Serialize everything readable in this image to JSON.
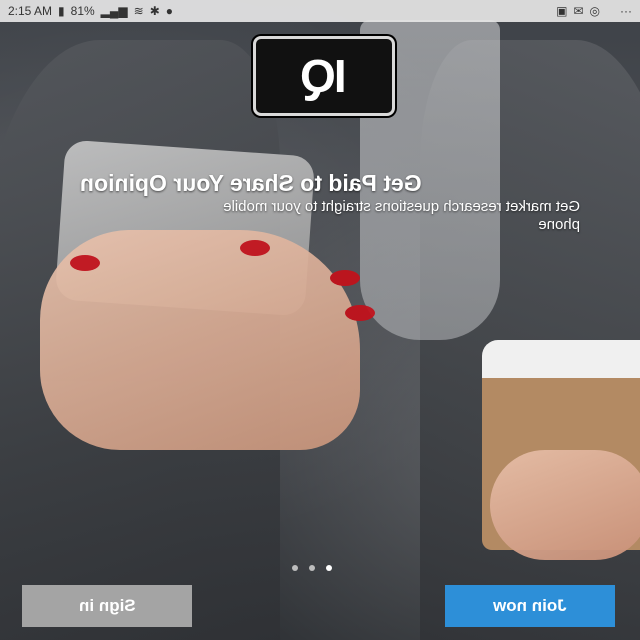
{
  "status_bar": {
    "time": "2:15 AM",
    "battery": "81%",
    "overflow": "···"
  },
  "logo": {
    "text": "IQ"
  },
  "hero": {
    "headline": "Get Paid to Share Your Opinion",
    "subtitle": "Get market research questions straight to your mobile phone"
  },
  "pager": {
    "count": 3,
    "active_index": 0
  },
  "buttons": {
    "sign_in": "Sign in",
    "join_now": "Join now"
  },
  "colors": {
    "join_now_bg": "#2d8fd8",
    "sign_in_bg": "#a4a4a4"
  }
}
